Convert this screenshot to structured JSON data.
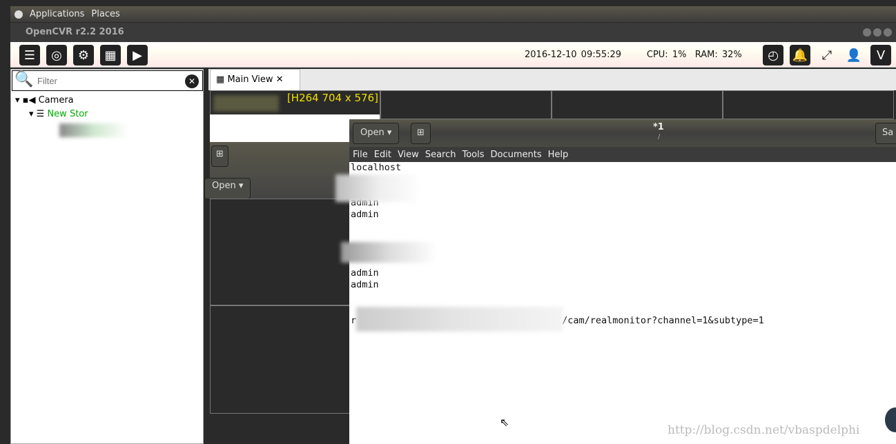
{
  "top_panel": {
    "applications": "Applications",
    "places": "Places"
  },
  "window": {
    "title": "OpenCVR r2.2 2016"
  },
  "toolbar": {
    "datetime": "2016-12-10 09:55:29",
    "cpu": "CPU: 1%",
    "ram": "RAM: 32%"
  },
  "sidebar": {
    "filter_placeholder": "Filter",
    "tree": [
      {
        "label": "Camera"
      },
      {
        "label": "New Stor",
        "color": "#00aa00"
      }
    ]
  },
  "main": {
    "tab_label": "Main View",
    "stream_info": "[H264 704 x 576]"
  },
  "gedit": {
    "open_label": "Open",
    "title": "*1",
    "subtitle": "/",
    "save_label": "Sa",
    "menu": [
      "File",
      "Edit",
      "View",
      "Search",
      "Tools",
      "Documents",
      "Help"
    ],
    "lines": [
      "localhost",
      "",
      "",
      "admin",
      "admin",
      "",
      "",
      "",
      "",
      "admin",
      "admin",
      "",
      "",
      "",
      "/cam/realmonitor?channel=1&subtype=1"
    ],
    "url_prefix": "r"
  },
  "behind": {
    "open_label": "Open"
  },
  "watermark": "http://blog.csdn.net/vbaspdelphi"
}
